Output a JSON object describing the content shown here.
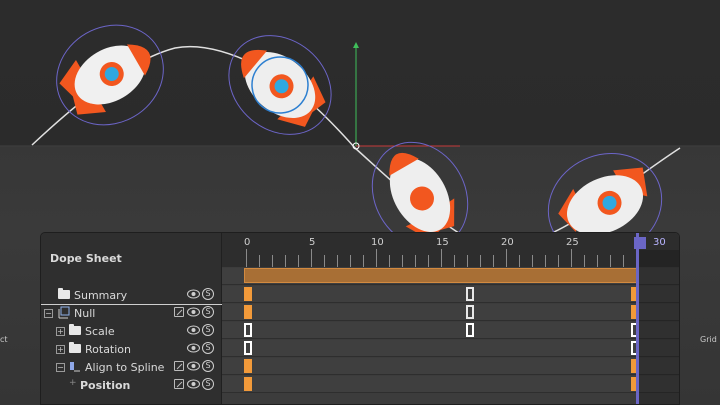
{
  "viewport": {
    "left_edge_label": "ct",
    "right_edge_label": "Grid"
  },
  "dope_sheet": {
    "title": "Dope Sheet",
    "ruler": {
      "labels": [
        "0",
        "5",
        "10",
        "15",
        "20",
        "25",
        "30"
      ],
      "current_frame": "30"
    },
    "tracks": [
      {
        "label": "Summary",
        "icon": "folder-icon",
        "solo": "S"
      },
      {
        "label": "Null",
        "icon": "null-object-icon",
        "solo": "S"
      },
      {
        "label": "Scale",
        "icon": "folder-icon",
        "solo": "S"
      },
      {
        "label": "Rotation",
        "icon": "folder-icon",
        "solo": "S"
      },
      {
        "label": "Align to Spline",
        "icon": "align-to-spline-tag-icon",
        "solo": "S"
      },
      {
        "label": "Position",
        "icon": "track-icon",
        "solo": "S"
      }
    ]
  },
  "colors": {
    "key_orange": "#f29a3a",
    "playhead": "#6b66c6",
    "summary_bar": "#a86f35"
  }
}
